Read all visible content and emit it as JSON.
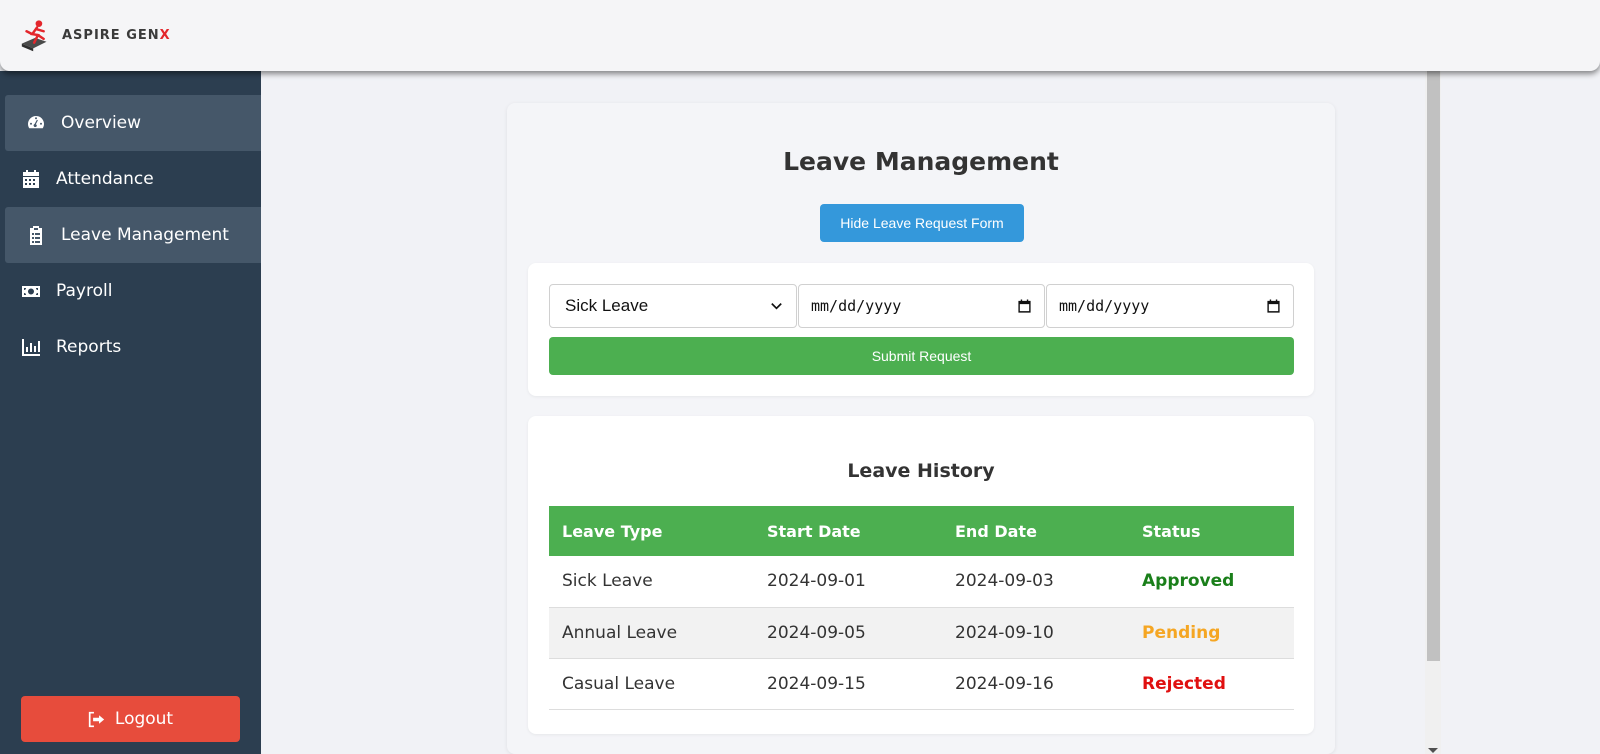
{
  "brand": {
    "name_main": "ASPIRE GEN",
    "name_accent": "X",
    "accent_color": "#e3262c"
  },
  "sidebar": {
    "items": [
      {
        "label": "Overview",
        "icon": "gauge-icon",
        "active": true
      },
      {
        "label": "Attendance",
        "icon": "calendar-icon",
        "active": false
      },
      {
        "label": "Leave Management",
        "icon": "clipboard-icon",
        "active": true
      },
      {
        "label": "Payroll",
        "icon": "money-icon",
        "active": false
      },
      {
        "label": "Reports",
        "icon": "bar-chart-icon",
        "active": false
      }
    ],
    "logout_label": "Logout",
    "background": "#2c3e50"
  },
  "main": {
    "title": "Leave Management",
    "toggle_button": "Hide Leave Request Form",
    "form": {
      "leave_type_selected": "Sick Leave",
      "start_date_placeholder": "mm/dd/yyyy",
      "end_date_placeholder": "mm/dd/yyyy",
      "submit_label": "Submit Request"
    },
    "history": {
      "title": "Leave History",
      "columns": [
        "Leave Type",
        "Start Date",
        "End Date",
        "Status"
      ],
      "rows": [
        {
          "type": "Sick Leave",
          "start": "2024-09-01",
          "end": "2024-09-03",
          "status": "Approved",
          "status_color": "#1a7f1a"
        },
        {
          "type": "Annual Leave",
          "start": "2024-09-05",
          "end": "2024-09-10",
          "status": "Pending",
          "status_color": "#f5a623"
        },
        {
          "type": "Casual Leave",
          "start": "2024-09-15",
          "end": "2024-09-16",
          "status": "Rejected",
          "status_color": "#e01010"
        }
      ]
    }
  },
  "colors": {
    "primary_blue": "#3498db",
    "success_green": "#4caf50",
    "logout_red": "#e74c3c"
  }
}
